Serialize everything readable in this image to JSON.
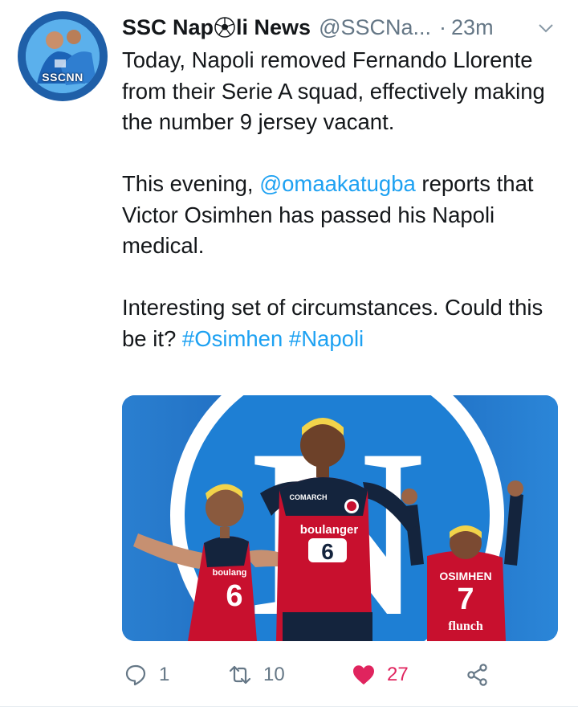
{
  "tweet": {
    "author": {
      "name_before": "SSC Nap",
      "name_after": "li News",
      "handle": "@SSCNa...",
      "avatar_label": "SSCNN"
    },
    "separator": "·",
    "time": "23m",
    "paragraph1": "Today, Napoli removed Fernando Llorente from their Serie A squad, effectively making the number 9 jersey vacant.",
    "paragraph2": {
      "before": "This evening, ",
      "mention": "@omaakatugba",
      "after": " reports that Victor Osimhen has passed his Napoli medical."
    },
    "paragraph3": {
      "before": "Interesting set of circumstances. Could this be it? ",
      "hashtag1": "#Osimhen",
      "space": " ",
      "hashtag2": "#Napoli"
    },
    "media": {
      "big_letter": "N",
      "shirt_sponsor_center": "boulanger",
      "shirt_number_center": "6",
      "shirt_brand_center": "COMARCH",
      "shirt_sponsor_left": "boulang",
      "shirt_number_left": "6",
      "shirt_name_right": "OSIMHEN",
      "shirt_number_right": "7",
      "shirt_sponsor_right": "flunch"
    },
    "actions": {
      "reply_count": "1",
      "retweet_count": "10",
      "like_count": "27"
    }
  },
  "colors": {
    "link": "#1da1f2",
    "like": "#e0245e",
    "muted": "#657786",
    "text": "#14171a"
  },
  "icons": [
    "reply-icon",
    "retweet-icon",
    "heart-icon",
    "share-icon",
    "chevron-down-icon",
    "football-icon"
  ]
}
